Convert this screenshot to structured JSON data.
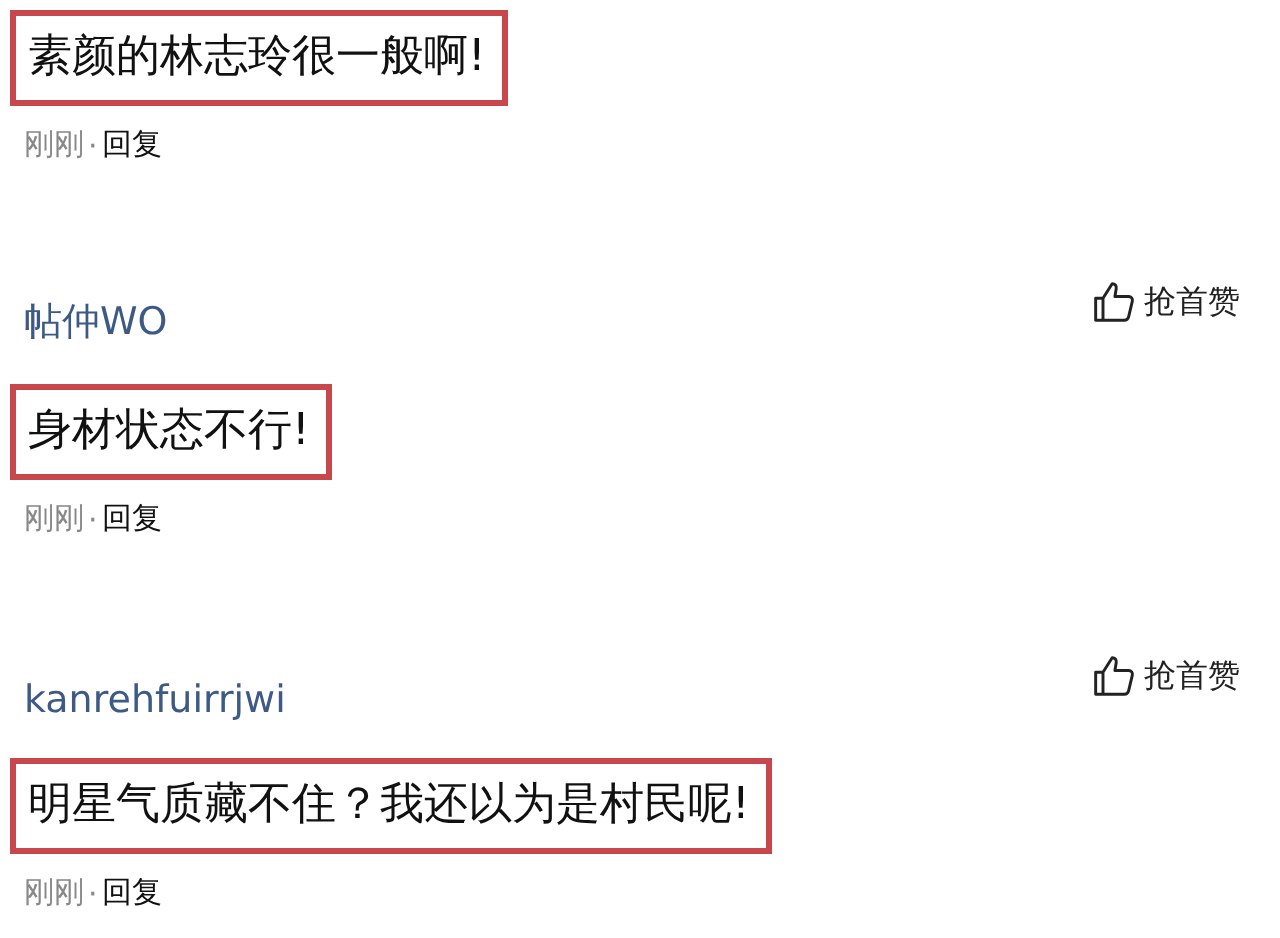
{
  "comments": [
    {
      "text": "素颜的林志玲很一般啊!",
      "highlighted": true,
      "time": "刚刚",
      "separator": "·",
      "reply": "回复"
    },
    {
      "user": "帖仲WO",
      "like": "抢首赞",
      "text": "身材状态不行!",
      "highlighted": true,
      "time": "刚刚",
      "separator": "·",
      "reply": "回复"
    },
    {
      "user": "kanrehfuirrjwi",
      "like": "抢首赞",
      "text": "明星气质藏不住？我还以为是村民呢!",
      "highlighted": true,
      "time": "刚刚",
      "separator": "·",
      "reply": "回复"
    }
  ]
}
